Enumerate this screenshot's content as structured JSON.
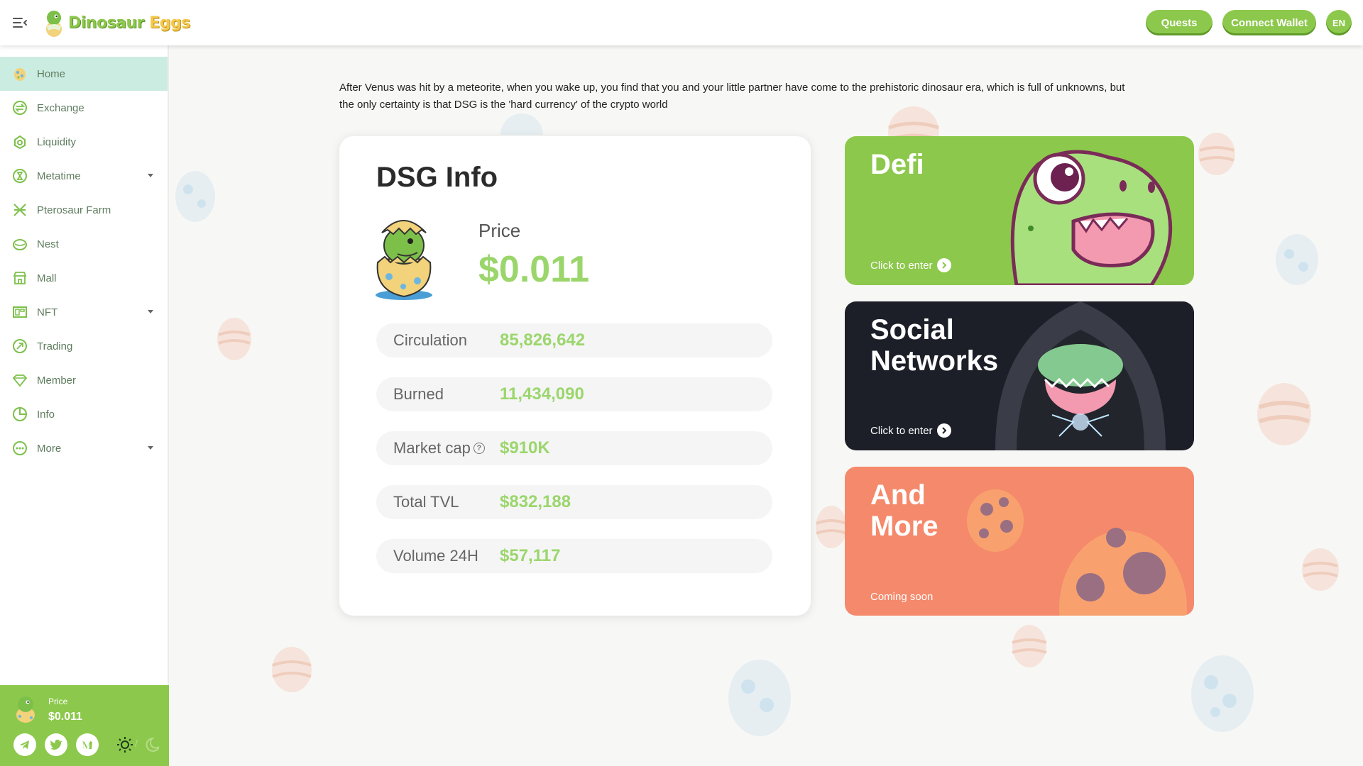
{
  "header": {
    "logo_word1": "Dinosaur",
    "logo_word2": "Eggs",
    "quests_label": "Quests",
    "wallet_label": "Connect Wallet",
    "lang_label": "EN"
  },
  "sidebar": {
    "items": [
      {
        "label": "Home",
        "icon": "home-egg-icon",
        "active": true
      },
      {
        "label": "Exchange",
        "icon": "exchange-icon"
      },
      {
        "label": "Liquidity",
        "icon": "liquidity-icon"
      },
      {
        "label": "Metatime",
        "icon": "hourglass-icon",
        "dropdown": true
      },
      {
        "label": "Pterosaur Farm",
        "icon": "farm-icon"
      },
      {
        "label": "Nest",
        "icon": "nest-icon"
      },
      {
        "label": "Mall",
        "icon": "shop-icon"
      },
      {
        "label": "NFT",
        "icon": "nft-icon",
        "dropdown": true
      },
      {
        "label": "Trading",
        "icon": "trading-icon"
      },
      {
        "label": "Member",
        "icon": "diamond-icon"
      },
      {
        "label": "Info",
        "icon": "pie-chart-icon"
      },
      {
        "label": "More",
        "icon": "more-icon",
        "dropdown": true
      }
    ],
    "footer": {
      "price_label": "Price",
      "price_value": "$0.011"
    }
  },
  "main": {
    "intro": "After Venus was hit by a meteorite, when you wake up, you find that you and your little partner have come to the prehistoric dinosaur era, which is full of unknowns, but the only certainty is that DSG is the 'hard currency' of the crypto world",
    "info": {
      "title": "DSG Info",
      "price_label": "Price",
      "price_value": "$0.011",
      "stats": [
        {
          "label": "Circulation",
          "value": "85,826,642"
        },
        {
          "label": "Burned",
          "value": "11,434,090"
        },
        {
          "label": "Market cap",
          "value": "$910K",
          "help": true
        },
        {
          "label": "Total TVL",
          "value": "$832,188"
        },
        {
          "label": "Volume 24H",
          "value": "$57,117"
        }
      ]
    },
    "cards": [
      {
        "title": "Defi",
        "cta": "Click to enter"
      },
      {
        "title": "Social Networks",
        "cta": "Click to enter"
      },
      {
        "title": "And More",
        "cta": "Coming soon"
      }
    ]
  },
  "colors": {
    "brand_green": "#8cc84b",
    "value_green": "#9bd66c",
    "active_nav_bg": "#cbece0",
    "social_card_bg": "#1c1f28",
    "more_card_bg": "#f5896b"
  }
}
